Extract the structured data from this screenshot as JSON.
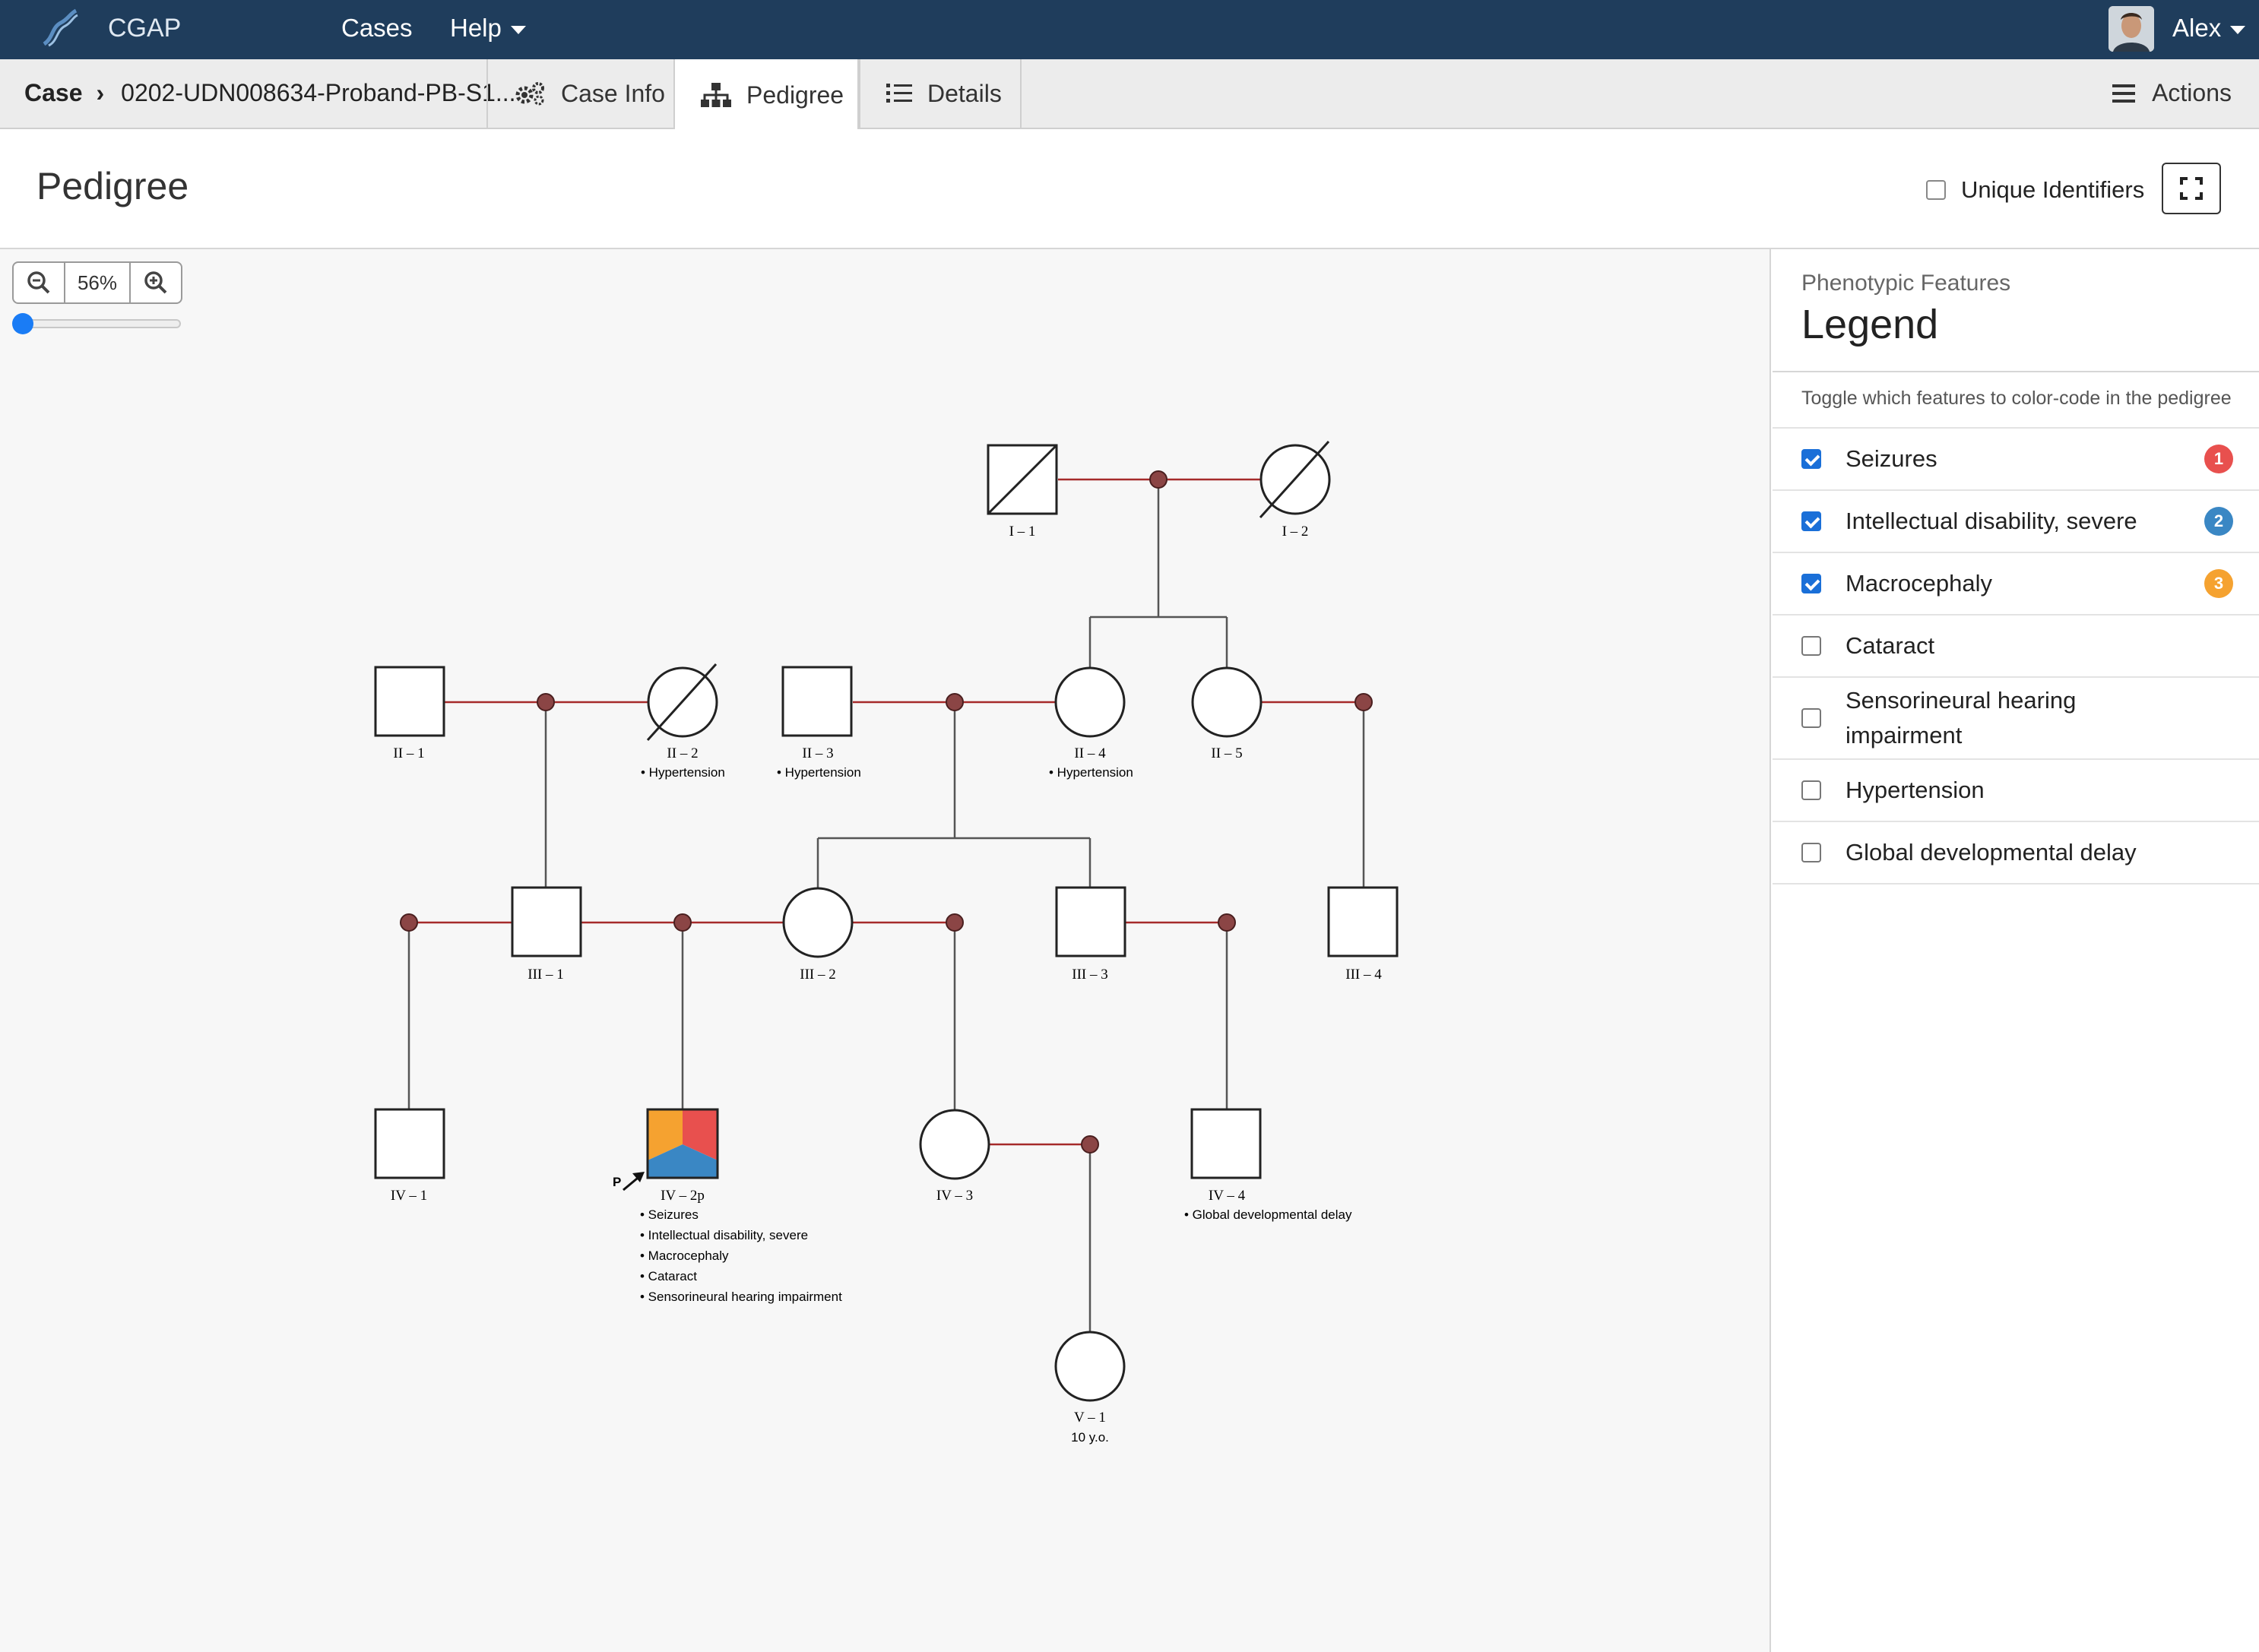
{
  "navbar": {
    "brand": "CGAP",
    "items": [
      {
        "label": "Cases"
      },
      {
        "label": "Help"
      }
    ],
    "user": "Alex"
  },
  "tabbar": {
    "crumb_root": "Case",
    "crumb_case": "0202-UDN008634-Proband-PB-S1...",
    "tabs": [
      {
        "label": "Case Info",
        "icon": "gears-icon"
      },
      {
        "label": "Pedigree",
        "icon": "sitemap-icon",
        "active": true
      },
      {
        "label": "Details",
        "icon": "list-icon"
      }
    ],
    "actions_label": "Actions"
  },
  "page": {
    "title": "Pedigree",
    "unique_identifiers_label": "Unique Identifiers"
  },
  "zoom": {
    "value": "56%",
    "slider_fraction": 0.0
  },
  "legend": {
    "subtitle": "Phenotypic Features",
    "title": "Legend",
    "description": "Toggle which features to color-code in the pedigree",
    "features": [
      {
        "label": "Seizures",
        "checked": true,
        "badge": "1",
        "color": "#e8504e"
      },
      {
        "label": "Intellectual disability, severe",
        "checked": true,
        "badge": "2",
        "color": "#3a87c4"
      },
      {
        "label": "Macrocephaly",
        "checked": true,
        "badge": "3",
        "color": "#f5a230"
      },
      {
        "label": "Cataract",
        "checked": false
      },
      {
        "label": "Sensorineural hearing impairment",
        "checked": false
      },
      {
        "label": "Hypertension",
        "checked": false
      },
      {
        "label": "Global developmental delay",
        "checked": false
      }
    ]
  },
  "pedigree": {
    "proband_marker": "P",
    "individuals": {
      "I-1": {
        "label": "I – 1",
        "sex": "male",
        "deceased": true
      },
      "I-2": {
        "label": "I – 2",
        "sex": "female",
        "deceased": true
      },
      "II-1": {
        "label": "II – 1",
        "sex": "male"
      },
      "II-2": {
        "label": "II – 2",
        "sex": "female",
        "deceased": true,
        "notes": [
          "• Hypertension"
        ]
      },
      "II-3": {
        "label": "II – 3",
        "sex": "male",
        "notes": [
          "• Hypertension"
        ]
      },
      "II-4": {
        "label": "II – 4",
        "sex": "female",
        "notes": [
          "• Hypertension"
        ]
      },
      "II-5": {
        "label": "II – 5",
        "sex": "female"
      },
      "III-1": {
        "label": "III – 1",
        "sex": "male"
      },
      "III-2": {
        "label": "III – 2",
        "sex": "female"
      },
      "III-3": {
        "label": "III – 3",
        "sex": "male"
      },
      "III-4": {
        "label": "III – 4",
        "sex": "male"
      },
      "IV-1": {
        "label": "IV – 1",
        "sex": "male"
      },
      "IV-2p": {
        "label": "IV – 2p",
        "sex": "male",
        "proband": true,
        "notes": [
          "• Seizures",
          "• Intellectual disability, severe",
          "• Macrocephaly",
          "• Cataract",
          "• Sensorineural hearing impairment"
        ]
      },
      "IV-3": {
        "label": "IV – 3",
        "sex": "female"
      },
      "IV-4": {
        "label": "IV – 4",
        "sex": "male",
        "notes": [
          "• Global developmental delay"
        ]
      },
      "V-1": {
        "label": "V – 1",
        "sex": "female",
        "notes": [
          "10 y.o."
        ]
      }
    }
  }
}
